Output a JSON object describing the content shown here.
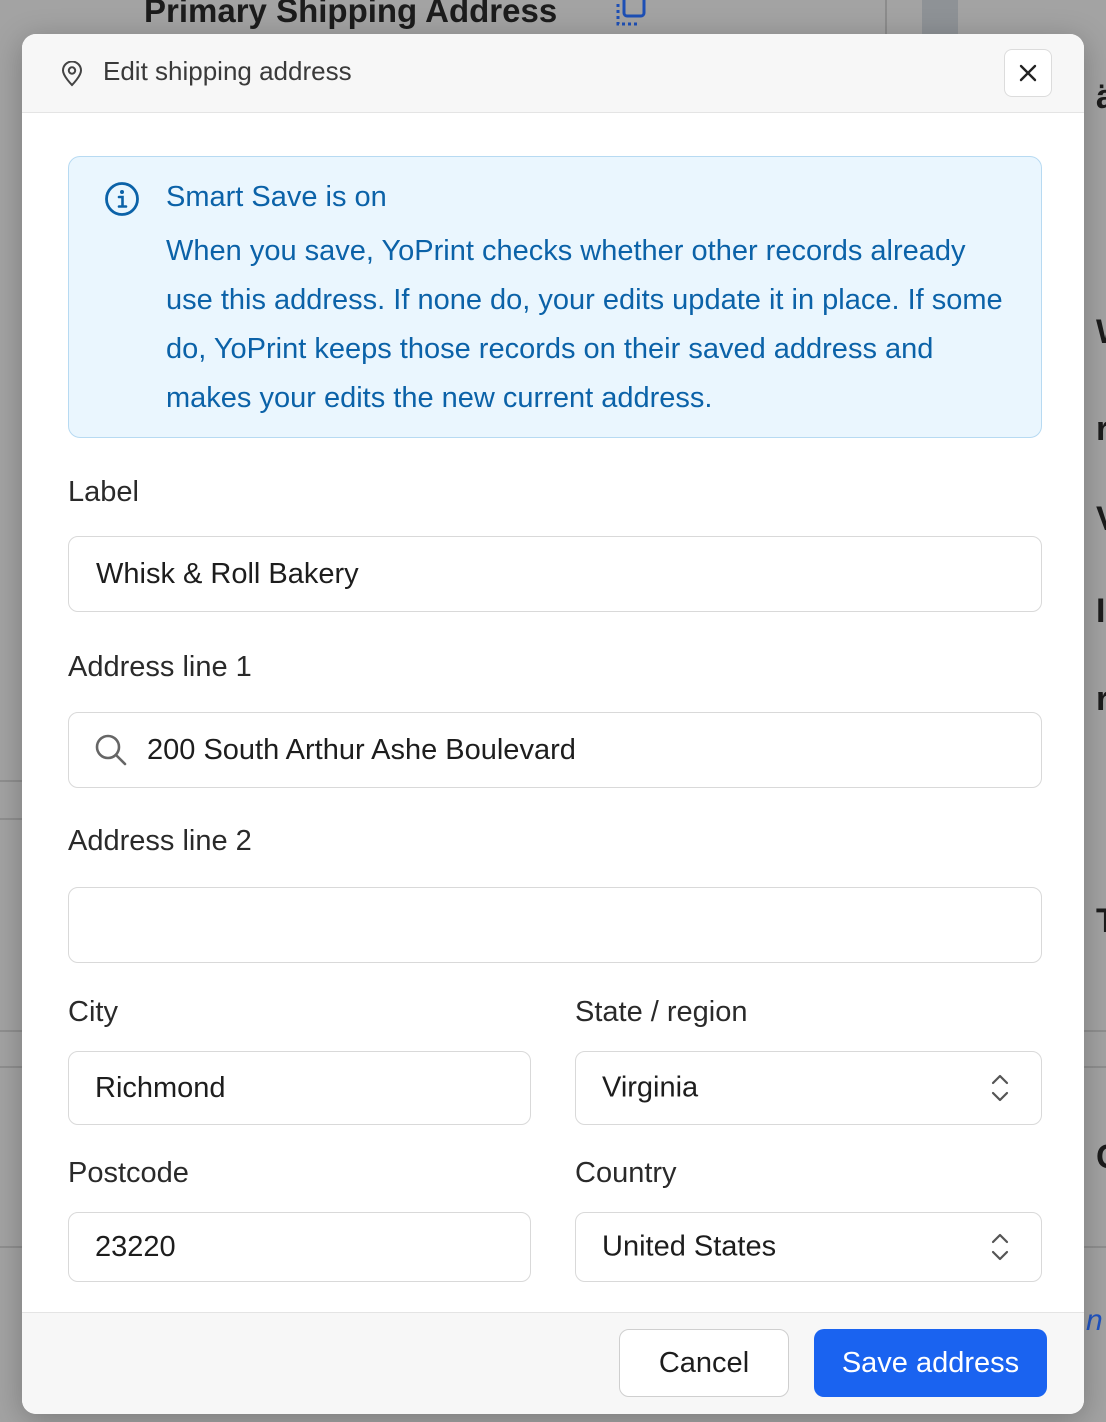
{
  "background": {
    "page_title": "Primary Shipping Address",
    "edge_letters": [
      "ä",
      "W",
      "r",
      "V",
      "I",
      "r",
      "T",
      "C"
    ],
    "edge_link": "n"
  },
  "modal": {
    "title": "Edit shipping address",
    "notice": {
      "title": "Smart Save is on",
      "body": "When you save, YoPrint checks whether other records already use this address. If none do, your edits update it in place. If some do, YoPrint keeps those records on their saved address and makes your edits the new current address."
    },
    "fields": {
      "label": {
        "label": "Label",
        "value": "Whisk & Roll Bakery"
      },
      "address1": {
        "label": "Address line 1",
        "value": "200 South Arthur Ashe Boulevard"
      },
      "address2": {
        "label": "Address line 2",
        "value": ""
      },
      "city": {
        "label": "City",
        "value": "Richmond"
      },
      "state": {
        "label": "State / region",
        "value": "Virginia"
      },
      "postcode": {
        "label": "Postcode",
        "value": "23220"
      },
      "country": {
        "label": "Country",
        "value": "United States"
      }
    },
    "footer": {
      "cancel_label": "Cancel",
      "save_label": "Save address"
    }
  },
  "icons": {
    "header": "map-pin-icon",
    "close": "close-icon",
    "notice": "info-icon",
    "address_search": "search-icon",
    "select": "chevron-up-down-icon"
  },
  "colors": {
    "primary": "#1a63f0",
    "notice_text": "#0b62a8",
    "notice_bg": "#eaf6fe",
    "notice_border": "#b7daf2"
  }
}
